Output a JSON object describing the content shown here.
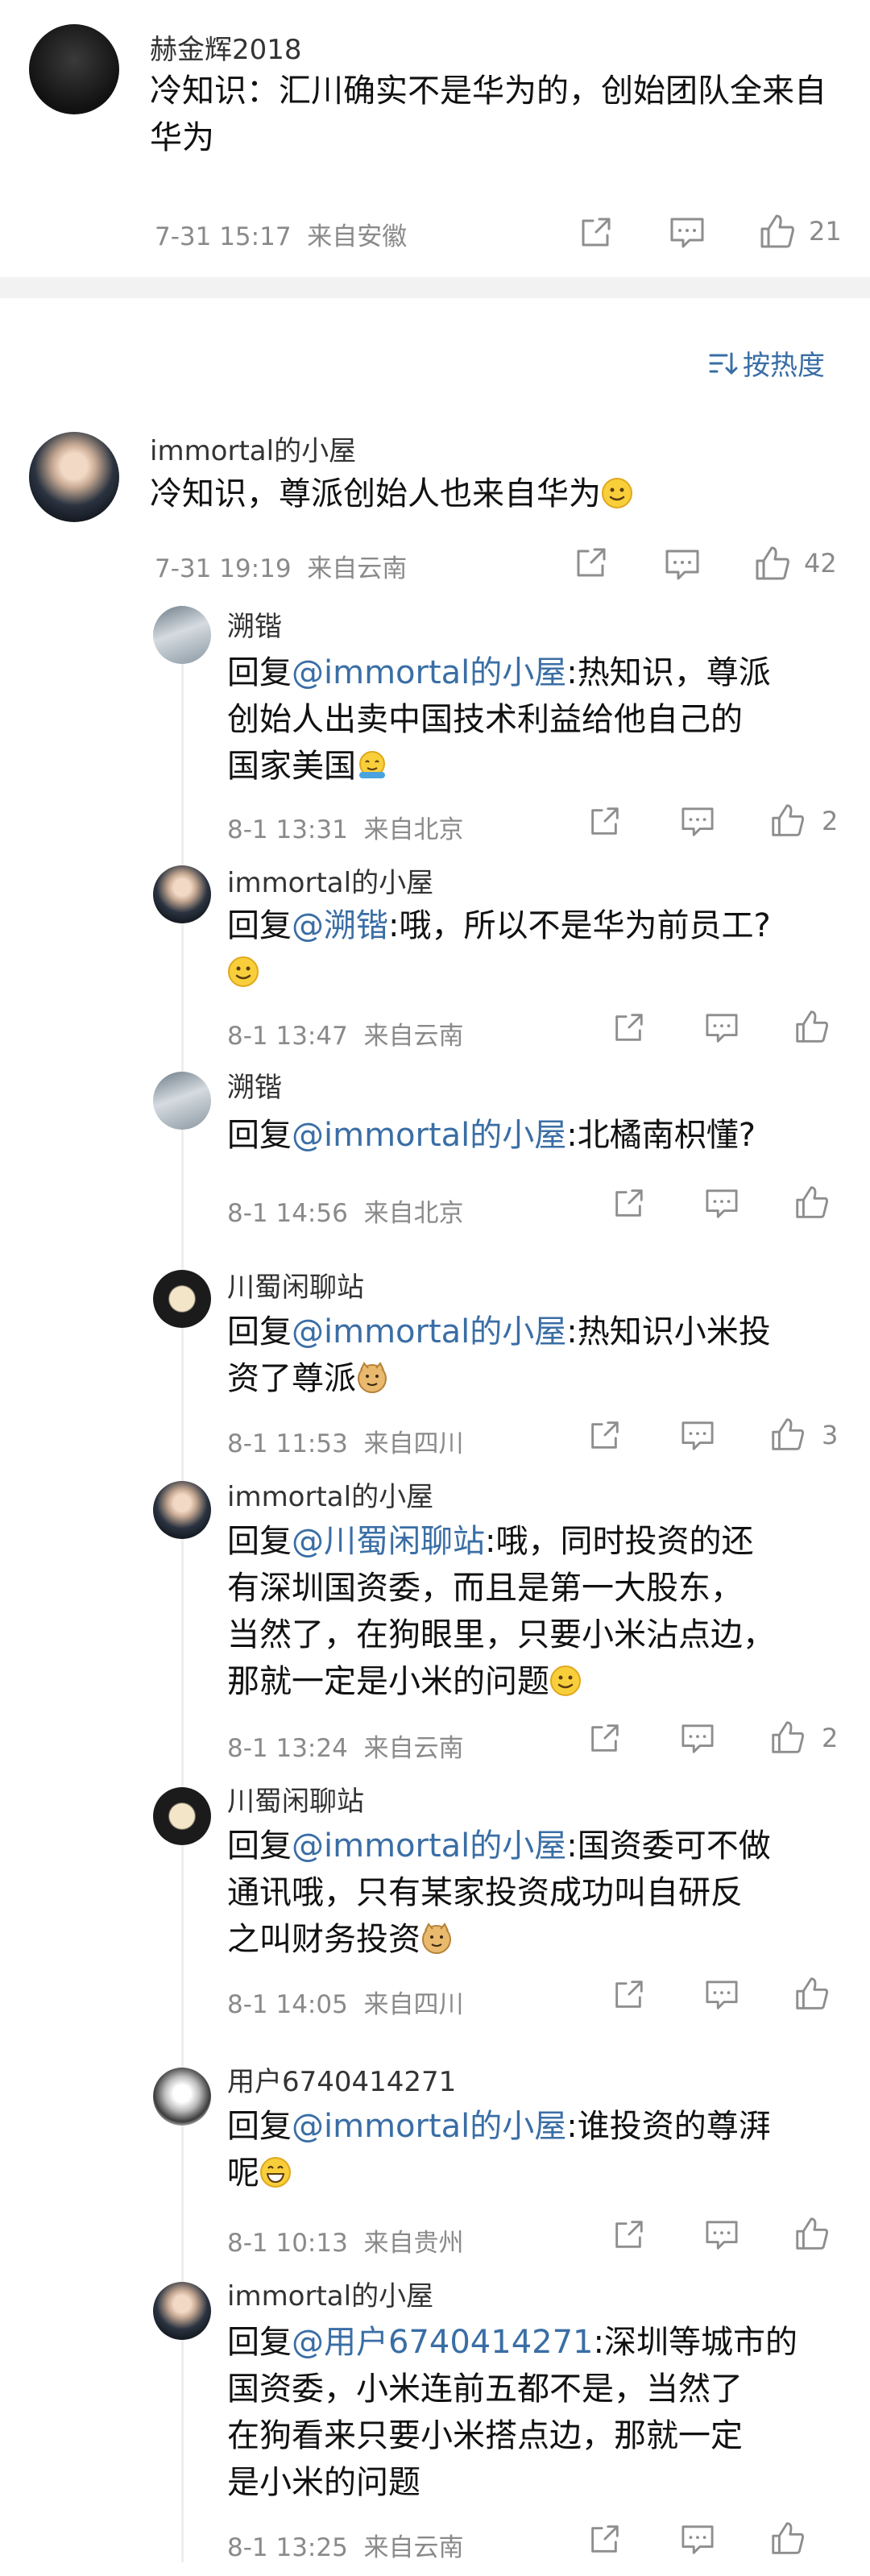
{
  "top_comment": {
    "user": "赫金辉2018",
    "text": "冷知识：汇川确实不是华为的，创始团队全来自华为",
    "meta": "7-31 15:17  来自安徽",
    "likes": "21"
  },
  "sort": {
    "label": "按热度",
    "icon": "sort-icon"
  },
  "main_comment": {
    "user": "immortal的小屋",
    "text": "冷知识，尊派创始人也来自华为",
    "meta": "7-31 19:19  来自云南",
    "likes": "42"
  },
  "replies": [
    {
      "user": "溯锴",
      "prefix": "回复",
      "mention": "@immortal的小屋",
      "line1": ":热知识，尊派",
      "line2": "创始人出卖中国技术利益给他自己的",
      "line3": "国家美国",
      "meta": "8-1 13:31  来自北京",
      "likes": "2"
    },
    {
      "user": "immortal的小屋",
      "prefix": "回复",
      "mention": "@溯锴",
      "line1": ":哦，所以不是华为前员工?",
      "meta": "8-1 13:47  来自云南",
      "likes": ""
    },
    {
      "user": "溯锴",
      "prefix": "回复",
      "mention": "@immortal的小屋",
      "line1": ":北橘南枳懂?",
      "meta": "8-1 14:56  来自北京",
      "likes": ""
    },
    {
      "user": "川蜀闲聊站",
      "prefix": "回复",
      "mention": "@immortal的小屋",
      "line1": ":热知识小米投",
      "line2": "资了尊派",
      "meta": "8-1 11:53  来自四川",
      "likes": "3"
    },
    {
      "user": "immortal的小屋",
      "prefix": "回复",
      "mention": "@川蜀闲聊站",
      "line1": ":哦，同时投资的还",
      "line2": "有深圳国资委，而且是第一大股东，",
      "line3": "当然了，在狗眼里，只要小米沾点边，",
      "line4": "那就一定是小米的问题",
      "meta": "8-1 13:24  来自云南",
      "likes": "2"
    },
    {
      "user": "川蜀闲聊站",
      "prefix": "回复",
      "mention": "@immortal的小屋",
      "line1": ":国资委可不做",
      "line2": "通讯哦，只有某家投资成功叫自研反",
      "line3": "之叫财务投资",
      "meta": "8-1 14:05  来自四川",
      "likes": ""
    },
    {
      "user": "用户6740414271",
      "prefix": "回复",
      "mention": "@immortal的小屋",
      "line1": ":谁投资的尊湃",
      "line2": "呢",
      "meta": "8-1 10:13  来自贵州",
      "likes": ""
    },
    {
      "user": "immortal的小屋",
      "prefix": "回复",
      "mention": "@用户6740414271",
      "line1": ":深圳等城市的",
      "line2": "国资委，小米连前五都不是，当然了",
      "line3": "在狗看来只要小米搭点边，那就一定",
      "line4": "是小米的问题",
      "meta": "8-1 13:25  来自云南",
      "likes": ""
    }
  ],
  "colors": {
    "link": "#3a6ea5",
    "meta": "#8a8a8a",
    "divider": "#f2f2f2"
  }
}
